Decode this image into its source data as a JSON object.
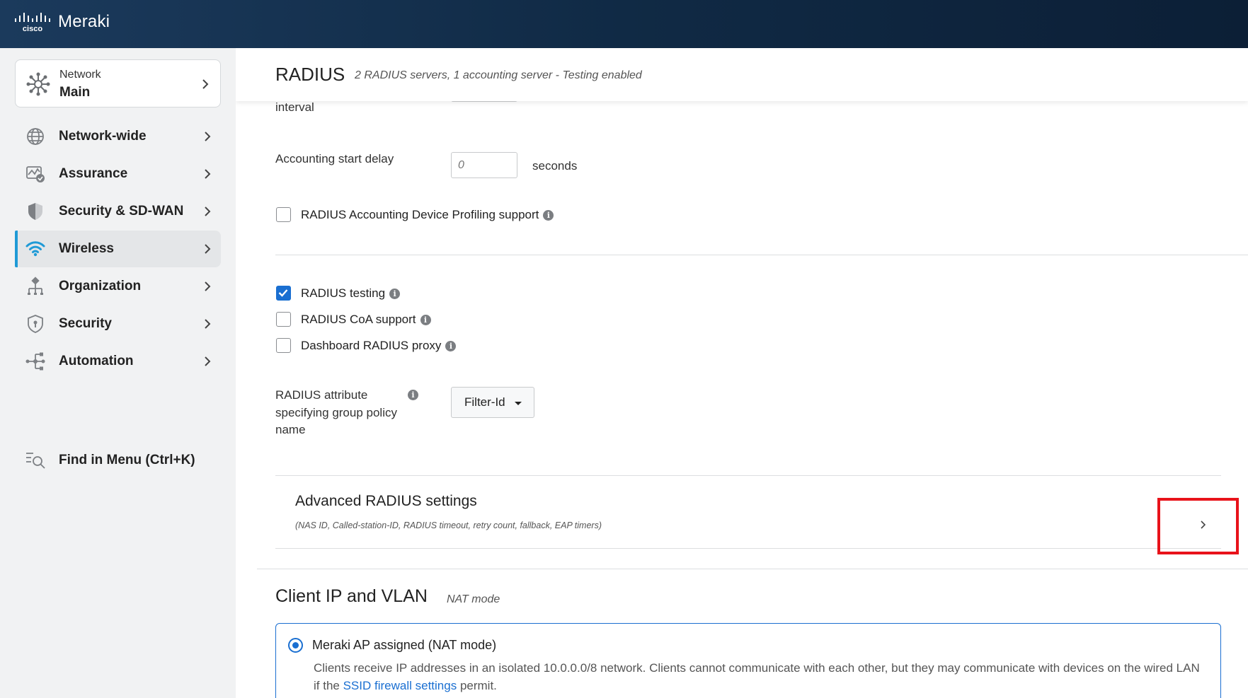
{
  "header": {
    "brand": "Meraki",
    "cisco_wordmark": "cisco"
  },
  "sidebar": {
    "network": {
      "label": "Network",
      "value": "Main"
    },
    "items": [
      {
        "label": "Network-wide",
        "icon": "network-wide-icon"
      },
      {
        "label": "Assurance",
        "icon": "assurance-icon"
      },
      {
        "label": "Security & SD-WAN",
        "icon": "shield-half-icon"
      },
      {
        "label": "Wireless",
        "icon": "wifi-icon",
        "active": true
      },
      {
        "label": "Organization",
        "icon": "organization-icon"
      },
      {
        "label": "Security",
        "icon": "security-shield-icon"
      },
      {
        "label": "Automation",
        "icon": "automation-icon"
      }
    ],
    "find": "Find in Menu (Ctrl+K)"
  },
  "page": {
    "title": "RADIUS",
    "subtitle": "2 RADIUS servers, 1 accounting server - Testing enabled"
  },
  "form": {
    "interval_label_cut": "interval",
    "accounting_start_delay": {
      "label": "Accounting start delay",
      "placeholder": "0",
      "unit": "seconds"
    },
    "device_profiling": {
      "label": "RADIUS Accounting Device Profiling support",
      "checked": false
    },
    "radius_testing": {
      "label": "RADIUS testing",
      "checked": true
    },
    "coa_support": {
      "label": "RADIUS CoA support",
      "checked": false
    },
    "radius_proxy": {
      "label": "Dashboard RADIUS proxy",
      "checked": false
    },
    "group_policy_attr": {
      "label_line1": "RADIUS attribute",
      "label_line2": "specifying group policy",
      "label_line3": "name",
      "value": "Filter-Id"
    },
    "advanced": {
      "title": "Advanced RADIUS settings",
      "subtitle": "(NAS ID, Called-station-ID, RADIUS timeout, retry count, fallback, EAP timers)"
    }
  },
  "client_ip": {
    "title": "Client IP and VLAN",
    "subtitle": "NAT mode",
    "option": {
      "title": "Meraki AP assigned (NAT mode)",
      "desc_before": "Clients receive IP addresses in an isolated 10.0.0.0/8 network. Clients cannot communicate with each other, but they may communicate with devices on the wired LAN if the ",
      "link": "SSID firewall settings",
      "desc_after": " permit.",
      "selected": true
    }
  },
  "colors": {
    "accent": "#1a6fd1",
    "active_bar": "#1f9ad6",
    "highlight": "#e8121a",
    "topbar": "#102a45"
  }
}
